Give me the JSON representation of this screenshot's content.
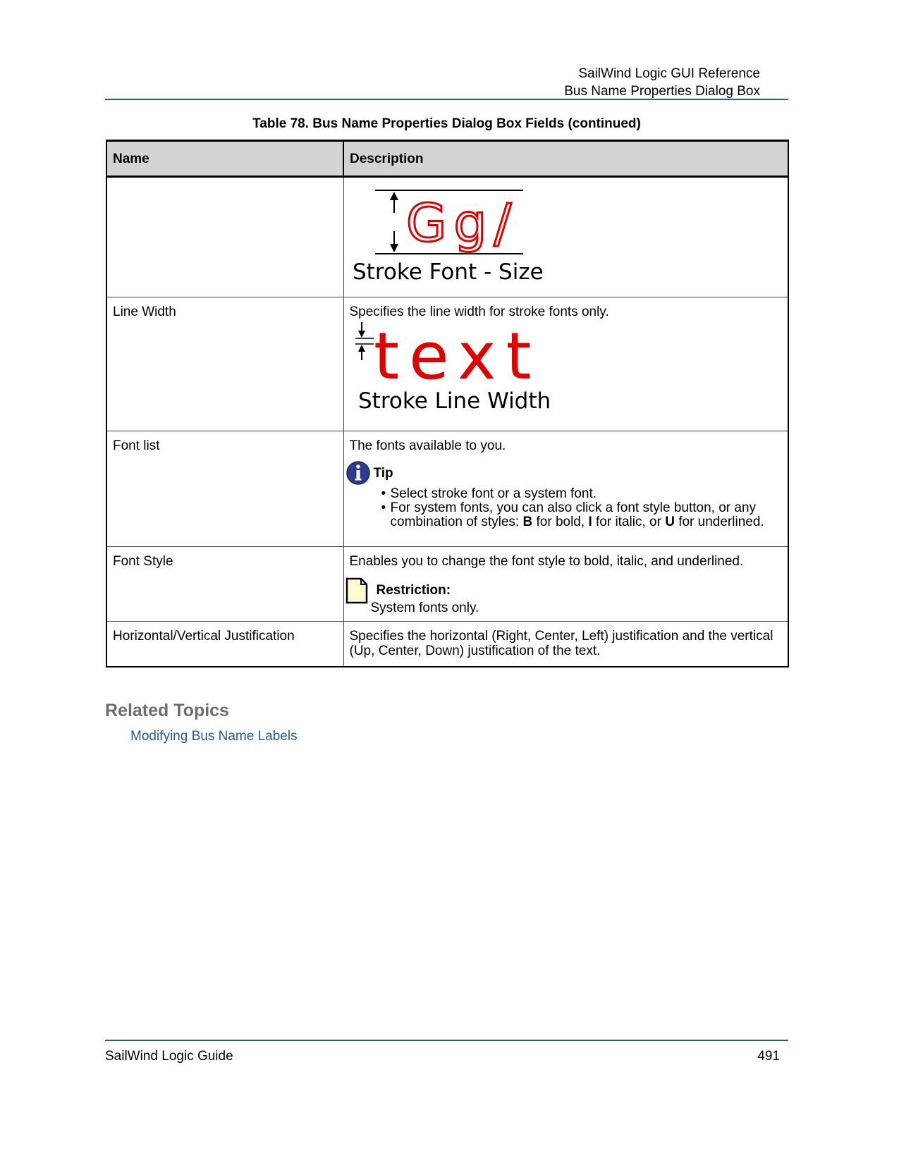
{
  "header": {
    "line1": "SailWind Logic GUI Reference",
    "line2": "Bus Name Properties Dialog Box"
  },
  "table": {
    "caption": "Table 78. Bus Name Properties Dialog Box Fields (continued)",
    "columns": [
      "Name",
      "Description"
    ],
    "rows": [
      {
        "name": "",
        "figure_label": "Stroke Font - Size",
        "figure_glyphs": "Gg/"
      },
      {
        "name": "Line Width",
        "description": "Specifies the line width for stroke fonts only.",
        "figure_label": "Stroke Line Width",
        "figure_glyphs": "text"
      },
      {
        "name": "Font list",
        "description": "The fonts available to you.",
        "tip_title": "Tip",
        "tip_items": [
          "Select stroke font or a system font."
        ],
        "tip_item2": {
          "prefix": "For system fonts, you can also click a font style button, or any combination of styles: ",
          "b": "B",
          "b_text": " for bold, ",
          "i": "I",
          "i_text": " for italic, or ",
          "u": "U",
          "u_text": " for underlined."
        }
      },
      {
        "name": "Font Style",
        "description": "Enables you to change the font style to bold, italic, and underlined.",
        "restriction_title": "Restriction:",
        "restriction_body": "System fonts only."
      },
      {
        "name": "Horizontal/Vertical Justification",
        "description": "Specifies the horizontal (Right, Center, Left) justification and the vertical (Up, Center, Down) justification of the text."
      }
    ]
  },
  "related": {
    "title": "Related Topics",
    "link": "Modifying Bus Name Labels"
  },
  "footer": {
    "left": "SailWind Logic Guide",
    "page": "491"
  },
  "colors": {
    "rule": "#1f5a99",
    "link": "#1f5a99",
    "figure_red": "#e00000",
    "header_fill": "#d3d3d3",
    "info_icon": "#2e3b8c"
  },
  "icons": [
    "up-arrow-icon",
    "down-arrow-icon",
    "info-icon",
    "note-icon"
  ]
}
